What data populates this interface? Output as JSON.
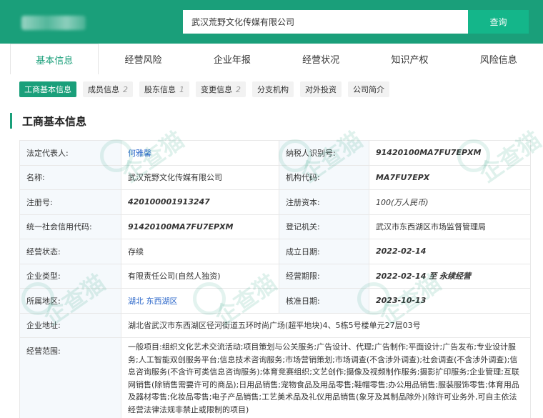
{
  "header": {
    "search_value": "武汉荒野文化传媒有限公司",
    "search_button": "查询"
  },
  "tabs": [
    {
      "label": "基本信息",
      "active": true
    },
    {
      "label": "经营风险"
    },
    {
      "label": "企业年报"
    },
    {
      "label": "经营状况"
    },
    {
      "label": "知识产权"
    },
    {
      "label": "风险信息"
    }
  ],
  "subtabs": [
    {
      "label": "工商基本信息",
      "count": "",
      "active": true
    },
    {
      "label": "成员信息",
      "count": "2"
    },
    {
      "label": "股东信息",
      "count": "1"
    },
    {
      "label": "变更信息",
      "count": "2"
    },
    {
      "label": "分支机构",
      "count": ""
    },
    {
      "label": "对外投资",
      "count": ""
    },
    {
      "label": "公司简介",
      "count": ""
    }
  ],
  "section_title": "工商基本信息",
  "watermark_text": "企查猫",
  "fields": {
    "legal_rep_label": "法定代表人:",
    "legal_rep": "何雅馨",
    "taxpayer_id_label": "纳税人识别号:",
    "taxpayer_id": "91420100MA7FU7EPXM",
    "name_label": "名称:",
    "name": "武汉荒野文化传媒有限公司",
    "org_code_label": "机构代码:",
    "org_code": "MA7FU7EPX",
    "reg_no_label": "注册号:",
    "reg_no": "420100001913247",
    "reg_capital_label": "注册资本:",
    "reg_capital": "100(万人民币)",
    "credit_code_label": "统一社会信用代码:",
    "credit_code": "91420100MA7FU7EPXM",
    "reg_authority_label": "登记机关:",
    "reg_authority": "武汉市东西湖区市场监督管理局",
    "status_label": "经营状态:",
    "status": "存续",
    "est_date_label": "成立日期:",
    "est_date": "2022-02-14",
    "type_label": "企业类型:",
    "type": "有限责任公司(自然人独资)",
    "term_label": "经营期限:",
    "term": "2022-02-14 至 永续经营",
    "region_label": "所属地区:",
    "region": "湖北 东西湖区",
    "approval_date_label": "核准日期:",
    "approval_date": "2023-10-13",
    "address_label": "企业地址:",
    "address": "湖北省武汉市东西湖区径河街道五环时尚广场(超平地块)4、5栋5号楼单元27层03号",
    "scope_label": "经营范围:",
    "scope": "一般项目:组织文化艺术交流活动;项目策划与公关服务;广告设计、代理;广告制作;平面设计;广告发布;专业设计服务;人工智能双创服务平台;信息技术咨询服务;市场营销策划;市场调查(不含涉外调查);社会调查(不含涉外调查);信息咨询服务(不含许可类信息咨询服务);体育竞赛组织;文艺创作;摄像及视频制作服务;摄影扩印服务;企业管理;互联网销售(除销售需要许可的商品);日用品销售;宠物食品及用品零售;鞋帽零售;办公用品销售;服装服饰零售;体育用品及器材零售;化妆品零售;电子产品销售;工艺美术品及礼仪用品销售(象牙及其制品除外)(除许可业务外,可自主依法经营法律法规非禁止或限制的项目)"
  }
}
